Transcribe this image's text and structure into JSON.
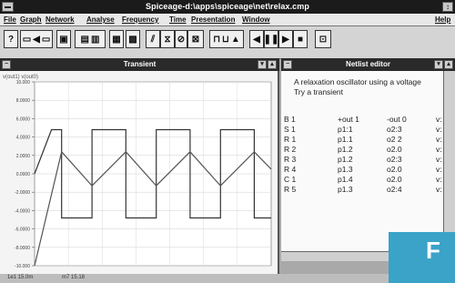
{
  "app": {
    "title": "Spiceage-d:\\apps\\spiceage\\net\\relax.cmp",
    "restore_glyph": "↕"
  },
  "menu": {
    "items": [
      "File",
      "Graph",
      "Network",
      "Analyse",
      "Frequency",
      "Time",
      "Presentation",
      "Window"
    ],
    "help": "Help"
  },
  "toolbar": {
    "icons": [
      "help-icon",
      "run-icon",
      "save-icon",
      "copy-icon",
      "edit-icon",
      "print-icon",
      "component-icon",
      "source-icon",
      "meter-icon",
      "circuit-icon",
      "analyse-icon",
      "step-icon",
      "play-icon",
      "stop-icon",
      "transient-icon"
    ]
  },
  "transient": {
    "title": "Transient",
    "btn_min": "▾",
    "btn_max": "▴",
    "y_ticks": [
      "10.000",
      "8.0000",
      "6.0000",
      "4.0000",
      "2.0000",
      "0.0000",
      "-2.0000",
      "-4.0000",
      "-6.0000",
      "-8.0000",
      "-10.000"
    ],
    "y_header": "v(out1) v(out0)",
    "status_left": "1e1 15.0m",
    "status_right": "m7 15.18"
  },
  "chart_data": {
    "type": "line",
    "series": [
      {
        "values": [
          [
            0,
            0
          ],
          [
            5,
            4.8
          ],
          [
            8,
            4.8
          ],
          [
            8,
            -4.8
          ],
          [
            17,
            -4.8
          ],
          [
            17,
            4.8
          ],
          [
            27,
            4.8
          ],
          [
            27,
            -4.8
          ],
          [
            36,
            -4.8
          ],
          [
            36,
            4.8
          ],
          [
            46,
            4.8
          ],
          [
            46,
            -4.8
          ],
          [
            55,
            -4.8
          ],
          [
            55,
            4.8
          ],
          [
            65,
            4.8
          ],
          [
            65,
            -4.8
          ],
          [
            70,
            -4.8
          ]
        ]
      },
      {
        "values": [
          [
            0,
            -10
          ],
          [
            8,
            2.4
          ],
          [
            17,
            -1.3
          ],
          [
            27,
            2.4
          ],
          [
            36,
            -1.3
          ],
          [
            46,
            2.4
          ],
          [
            55,
            -1.3
          ],
          [
            65,
            2.4
          ],
          [
            70,
            0.5
          ]
        ]
      }
    ],
    "xlim": [
      0,
      70
    ],
    "ylim": [
      -10,
      10
    ],
    "grid": true
  },
  "netlist": {
    "title": "Netlist editor",
    "comments": [
      "A relaxation oscillator using a voltage",
      "Try a transient"
    ],
    "rows": [
      {
        "name": "B 1",
        "n1": "+out 1",
        "n2": "-out 0",
        "v": "v:"
      },
      {
        "name": "S 1",
        "n1": "p1:1",
        "n2": "o2:3",
        "v": "v:"
      },
      {
        "name": "R 1",
        "n1": "p1.1",
        "n2": "o2 2",
        "v": "v:"
      },
      {
        "name": "R 2",
        "n1": "p1.2",
        "n2": "o2.0",
        "v": "v:"
      },
      {
        "name": "R 3",
        "n1": "p1.2",
        "n2": "o2:3",
        "v": "v:"
      },
      {
        "name": "R 4",
        "n1": "p1.3",
        "n2": "o2.0",
        "v": "v:"
      },
      {
        "name": "C 1",
        "n1": "p1.4",
        "n2": "o2.0",
        "v": "v:"
      },
      {
        "name": "R 5",
        "n1": "p1.3",
        "n2": "o2:4",
        "v": "v:"
      }
    ]
  },
  "overlay": {
    "letter": "F",
    "color": "#3aa3c7"
  }
}
